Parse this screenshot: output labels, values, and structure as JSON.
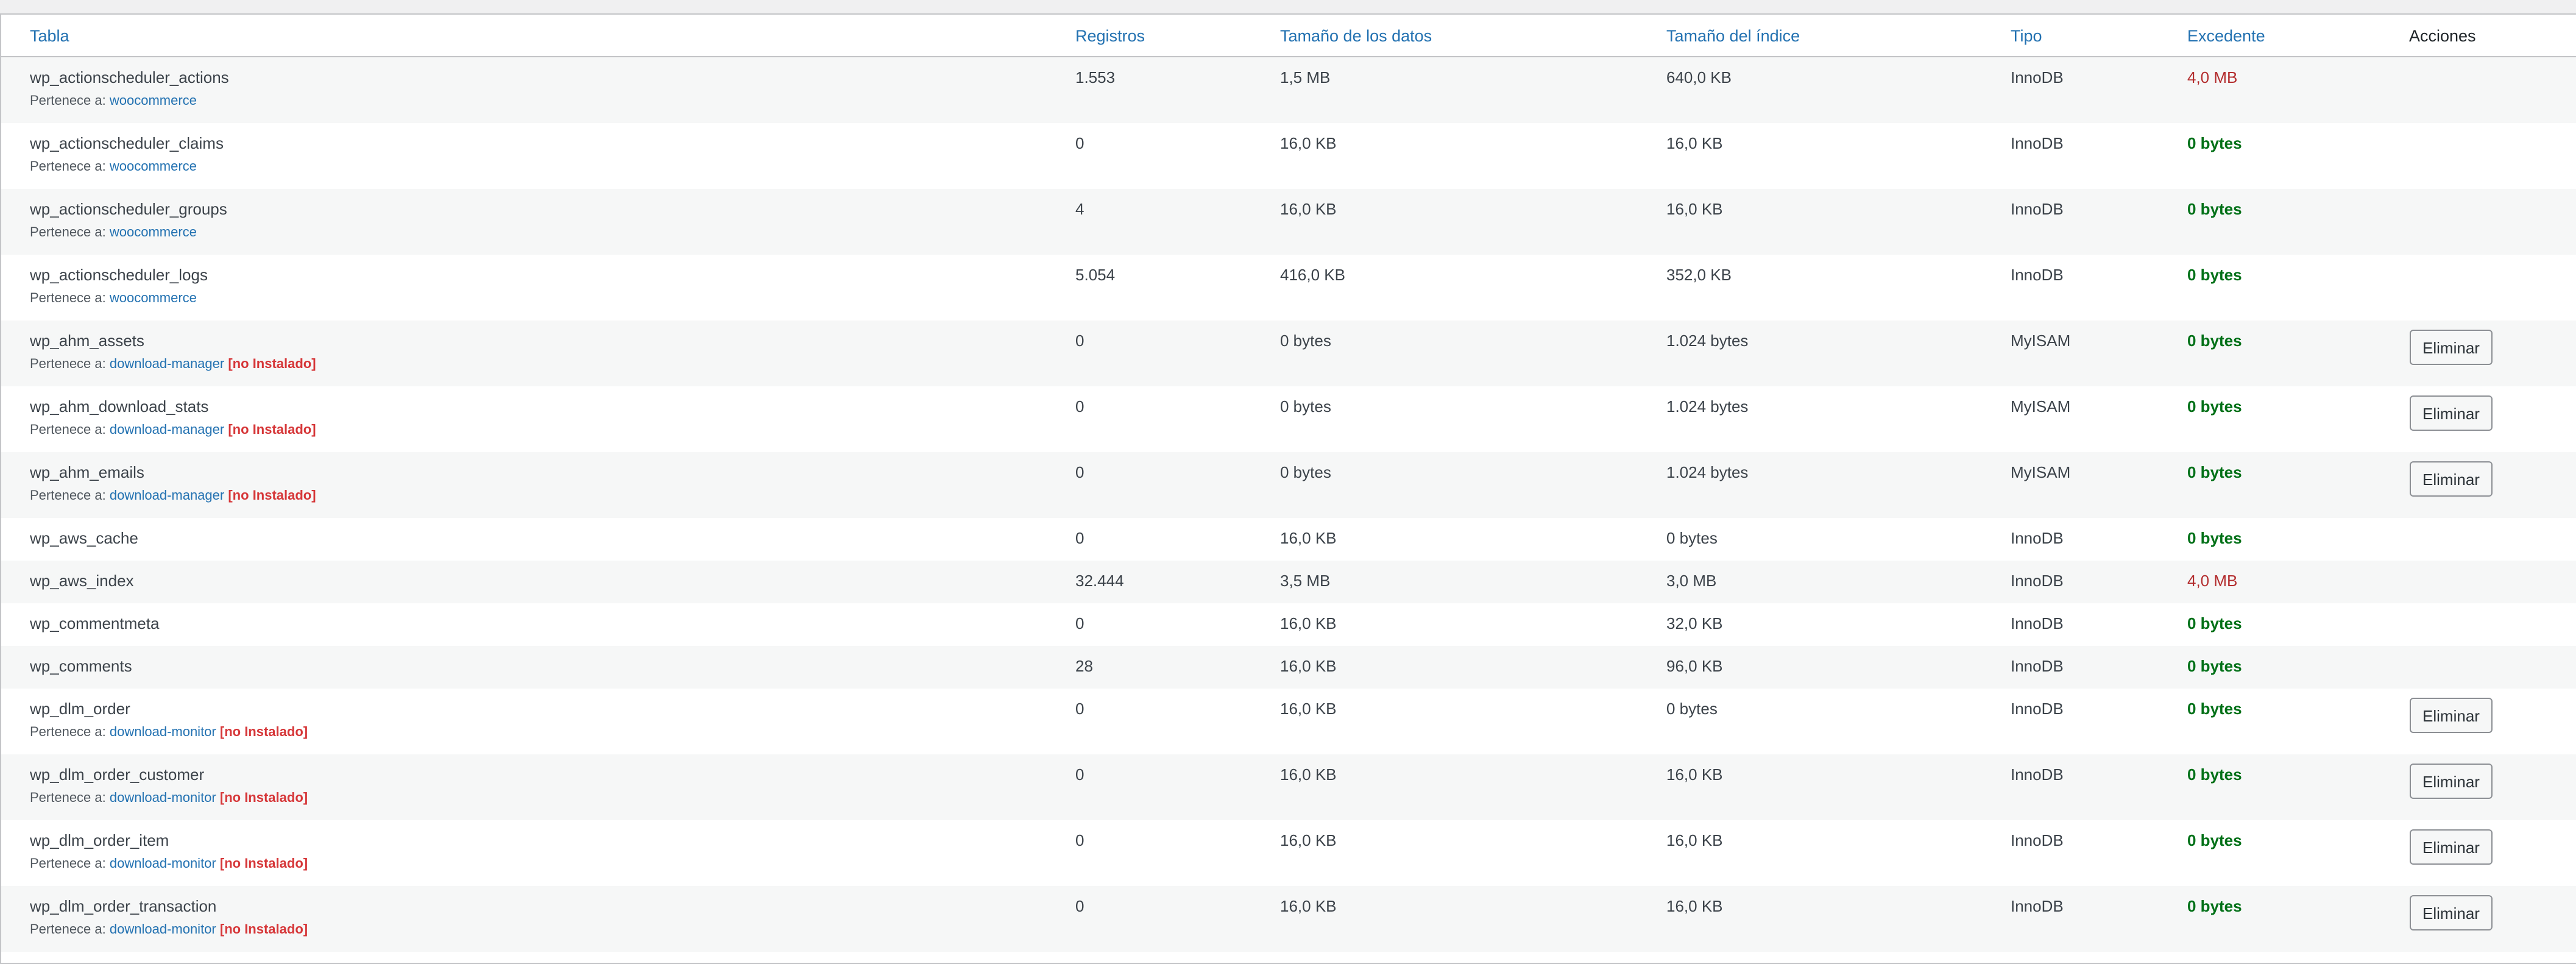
{
  "headers": {
    "table": "Tabla",
    "records": "Registros",
    "data_size": "Tamaño de los datos",
    "index_size": "Tamaño del índice",
    "type": "Tipo",
    "overhead": "Excedente",
    "actions": "Acciones"
  },
  "labels": {
    "belongs_to": "Pertenece a:",
    "not_installed": "[no Instalado]",
    "delete_button": "Eliminar"
  },
  "colors": {
    "link": "#2271b1",
    "overhead_high": "#b32d2e",
    "overhead_ok": "#007017",
    "not_installed": "#d63638"
  },
  "rows": [
    {
      "name": "wp_actionscheduler_actions",
      "owner": "woocommerce",
      "not_installed": false,
      "records": "1.553",
      "data_size": "1,5 MB",
      "index_size": "640,0 KB",
      "type": "InnoDB",
      "overhead": "4,0 MB",
      "overhead_high": true,
      "can_delete": false
    },
    {
      "name": "wp_actionscheduler_claims",
      "owner": "woocommerce",
      "not_installed": false,
      "records": "0",
      "data_size": "16,0 KB",
      "index_size": "16,0 KB",
      "type": "InnoDB",
      "overhead": "0 bytes",
      "overhead_high": false,
      "can_delete": false
    },
    {
      "name": "wp_actionscheduler_groups",
      "owner": "woocommerce",
      "not_installed": false,
      "records": "4",
      "data_size": "16,0 KB",
      "index_size": "16,0 KB",
      "type": "InnoDB",
      "overhead": "0 bytes",
      "overhead_high": false,
      "can_delete": false
    },
    {
      "name": "wp_actionscheduler_logs",
      "owner": "woocommerce",
      "not_installed": false,
      "records": "5.054",
      "data_size": "416,0 KB",
      "index_size": "352,0 KB",
      "type": "InnoDB",
      "overhead": "0 bytes",
      "overhead_high": false,
      "can_delete": false
    },
    {
      "name": "wp_ahm_assets",
      "owner": "download-manager",
      "not_installed": true,
      "records": "0",
      "data_size": "0 bytes",
      "index_size": "1.024 bytes",
      "type": "MyISAM",
      "overhead": "0 bytes",
      "overhead_high": false,
      "can_delete": true
    },
    {
      "name": "wp_ahm_download_stats",
      "owner": "download-manager",
      "not_installed": true,
      "records": "0",
      "data_size": "0 bytes",
      "index_size": "1.024 bytes",
      "type": "MyISAM",
      "overhead": "0 bytes",
      "overhead_high": false,
      "can_delete": true
    },
    {
      "name": "wp_ahm_emails",
      "owner": "download-manager",
      "not_installed": true,
      "records": "0",
      "data_size": "0 bytes",
      "index_size": "1.024 bytes",
      "type": "MyISAM",
      "overhead": "0 bytes",
      "overhead_high": false,
      "can_delete": true
    },
    {
      "name": "wp_aws_cache",
      "owner": null,
      "not_installed": false,
      "records": "0",
      "data_size": "16,0 KB",
      "index_size": "0 bytes",
      "type": "InnoDB",
      "overhead": "0 bytes",
      "overhead_high": false,
      "can_delete": false
    },
    {
      "name": "wp_aws_index",
      "owner": null,
      "not_installed": false,
      "records": "32.444",
      "data_size": "3,5 MB",
      "index_size": "3,0 MB",
      "type": "InnoDB",
      "overhead": "4,0 MB",
      "overhead_high": true,
      "can_delete": false
    },
    {
      "name": "wp_commentmeta",
      "owner": null,
      "not_installed": false,
      "records": "0",
      "data_size": "16,0 KB",
      "index_size": "32,0 KB",
      "type": "InnoDB",
      "overhead": "0 bytes",
      "overhead_high": false,
      "can_delete": false
    },
    {
      "name": "wp_comments",
      "owner": null,
      "not_installed": false,
      "records": "28",
      "data_size": "16,0 KB",
      "index_size": "96,0 KB",
      "type": "InnoDB",
      "overhead": "0 bytes",
      "overhead_high": false,
      "can_delete": false
    },
    {
      "name": "wp_dlm_order",
      "owner": "download-monitor",
      "not_installed": true,
      "records": "0",
      "data_size": "16,0 KB",
      "index_size": "0 bytes",
      "type": "InnoDB",
      "overhead": "0 bytes",
      "overhead_high": false,
      "can_delete": true
    },
    {
      "name": "wp_dlm_order_customer",
      "owner": "download-monitor",
      "not_installed": true,
      "records": "0",
      "data_size": "16,0 KB",
      "index_size": "16,0 KB",
      "type": "InnoDB",
      "overhead": "0 bytes",
      "overhead_high": false,
      "can_delete": true
    },
    {
      "name": "wp_dlm_order_item",
      "owner": "download-monitor",
      "not_installed": true,
      "records": "0",
      "data_size": "16,0 KB",
      "index_size": "16,0 KB",
      "type": "InnoDB",
      "overhead": "0 bytes",
      "overhead_high": false,
      "can_delete": true
    },
    {
      "name": "wp_dlm_order_transaction",
      "owner": "download-monitor",
      "not_installed": true,
      "records": "0",
      "data_size": "16,0 KB",
      "index_size": "16,0 KB",
      "type": "InnoDB",
      "overhead": "0 bytes",
      "overhead_high": false,
      "can_delete": true
    }
  ]
}
